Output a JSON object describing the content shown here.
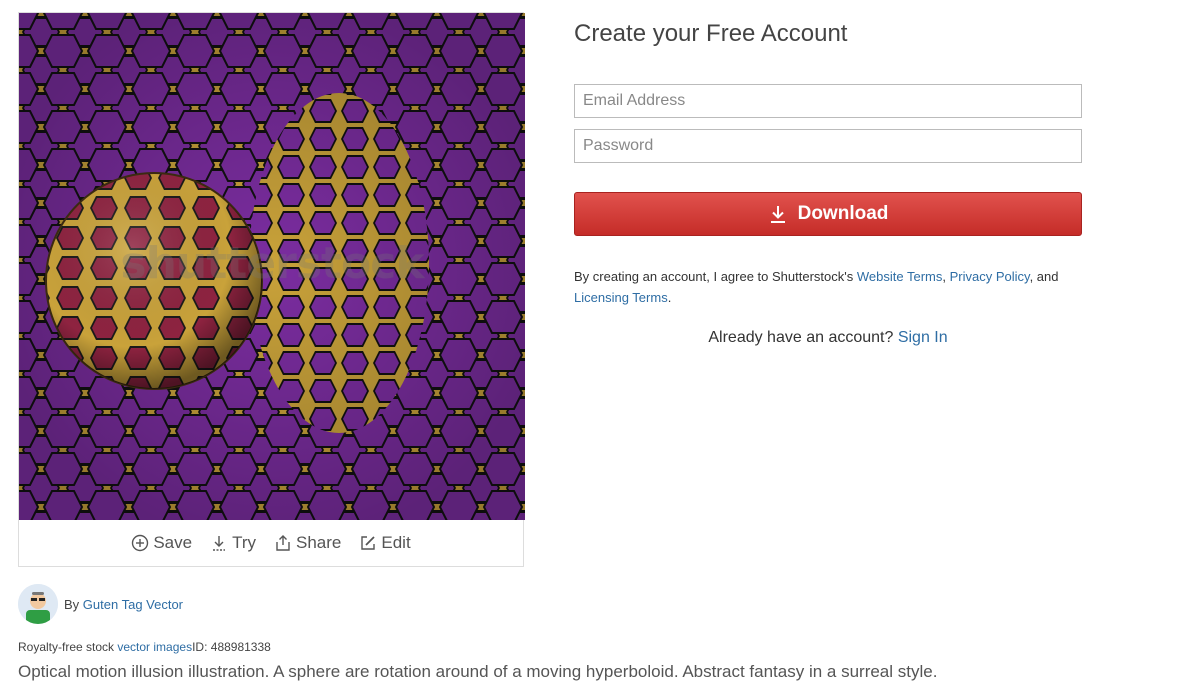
{
  "preview": {
    "watermark": "shutterstock",
    "colors": {
      "purple": "#7b2da0",
      "gold": "#c9a23a",
      "red": "#8e2340"
    }
  },
  "actions": {
    "save": "Save",
    "try": "Try",
    "share": "Share",
    "edit": "Edit"
  },
  "author": {
    "by_label": "By",
    "name": "Guten Tag Vector"
  },
  "meta": {
    "prefix": "Royalty-free stock",
    "link": "vector images",
    "id_label": "ID:",
    "id": "488981338"
  },
  "description": "Optical motion illusion illustration. A sphere are rotation around of a moving hyperboloid. Abstract fantasy in a surreal style.",
  "form": {
    "title": "Create your Free Account",
    "email_placeholder": "Email Address",
    "password_placeholder": "Password",
    "download_label": "Download",
    "terms_prefix": "By creating an account, I agree to Shutterstock's",
    "terms_link1": "Website Terms",
    "terms_sep": ",",
    "terms_link2": "Privacy Policy",
    "terms_and": ", and",
    "terms_link3": "Licensing Terms",
    "terms_end": ".",
    "signin_prompt": "Already have an account?",
    "signin_link": "Sign In",
    "accent_red": "#d63c37",
    "link_blue": "#2e6da4"
  }
}
